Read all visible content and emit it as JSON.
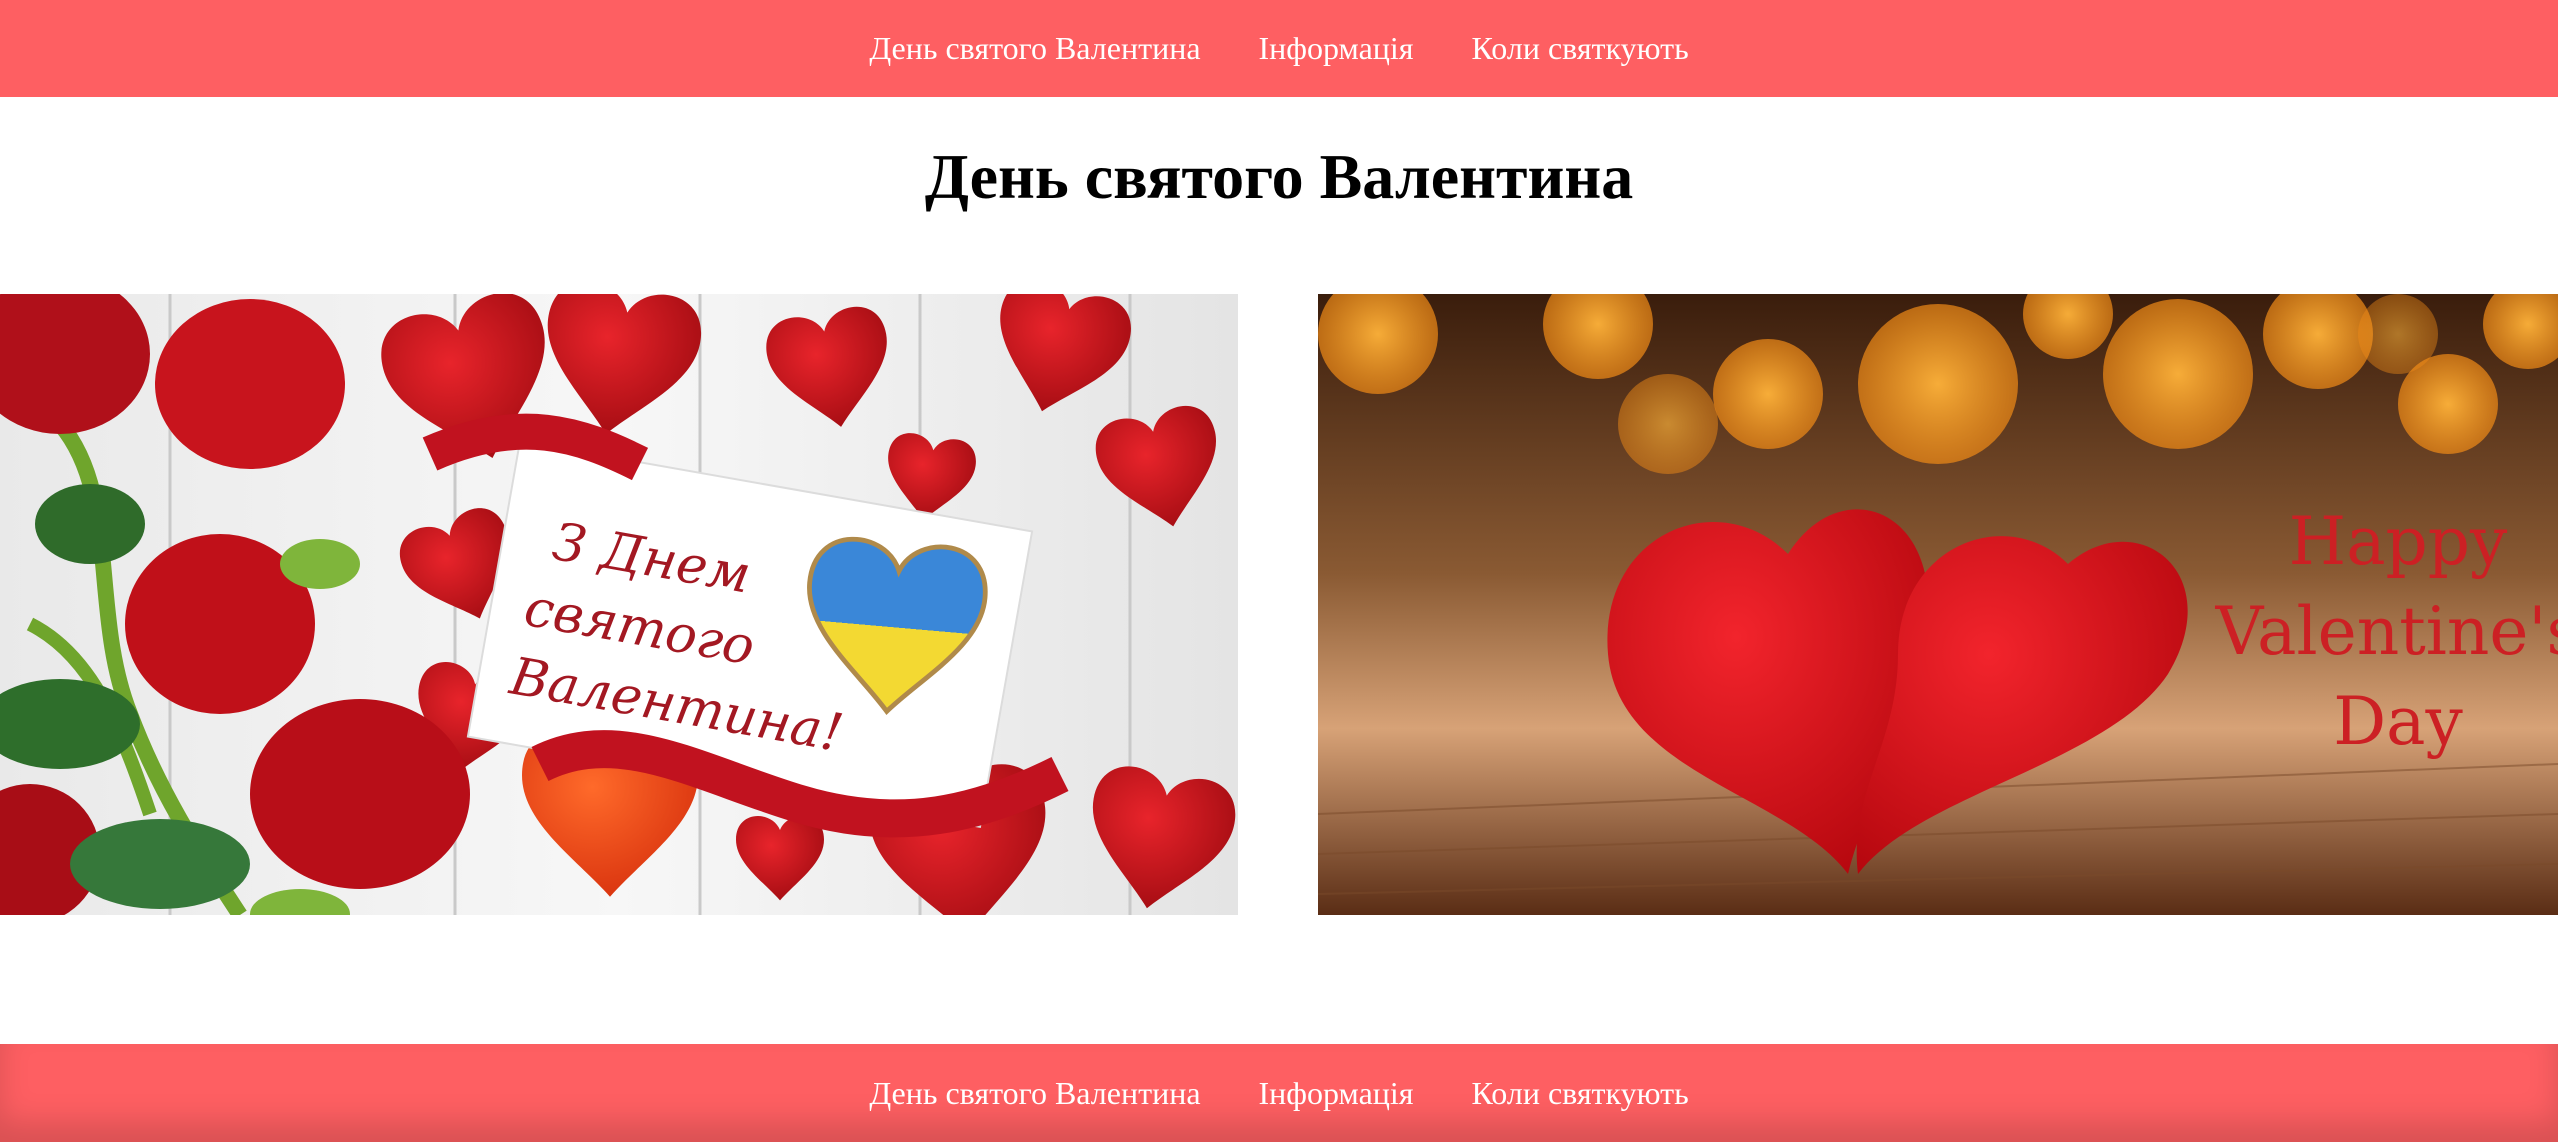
{
  "nav": {
    "items": [
      {
        "label": "День святого Валентина"
      },
      {
        "label": "Інформація"
      },
      {
        "label": "Коли святкують"
      }
    ]
  },
  "footer_nav": {
    "items": [
      {
        "label": "День святого Валентина"
      },
      {
        "label": "Інформація"
      },
      {
        "label": "Коли святкують"
      }
    ]
  },
  "main": {
    "title": "День святого Валентина"
  },
  "gallery": {
    "left_image": {
      "card_text": [
        "З Днем",
        "святого",
        "Валентина!"
      ]
    },
    "right_image": {
      "text": [
        "Happy",
        "Valentine's",
        "Day"
      ]
    }
  },
  "colors": {
    "navbar_bg": "#fe5f62",
    "nav_text": "#ffffff",
    "title_text": "#000000"
  }
}
